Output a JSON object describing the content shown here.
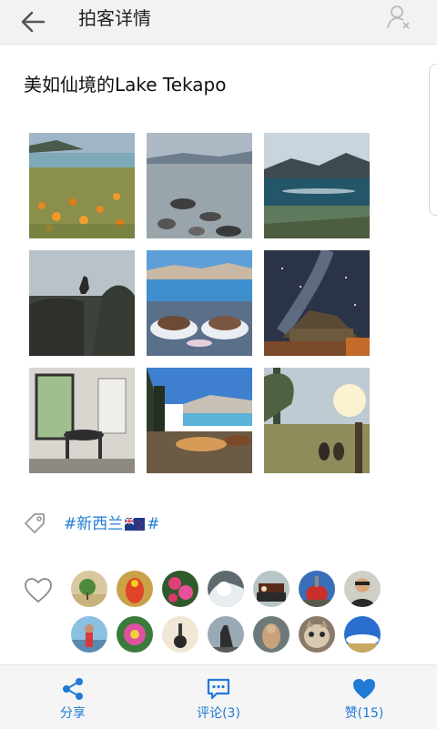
{
  "header": {
    "title": "拍客详情"
  },
  "post": {
    "title": "美如仙境的Lake Tekapo"
  },
  "tag": {
    "prefix": "#新西兰",
    "suffix": "#"
  },
  "actions": {
    "share": "分享",
    "comment": "评论(3)",
    "like": "赞(15)"
  },
  "colors": {
    "accent": "#1f7ad6"
  }
}
